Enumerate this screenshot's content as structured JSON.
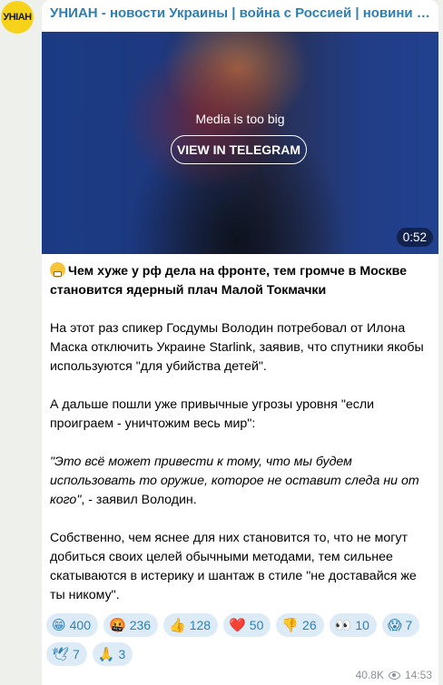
{
  "channel": {
    "avatar_text": "УНІАН",
    "title": "УНИАН - новости Украины | война с Россией | новини України | Україна | Ukraine"
  },
  "media": {
    "notice": "Media is too big",
    "button_label": "VIEW IN TELEGRAM",
    "duration": "0:52"
  },
  "message": {
    "headline": "Чем хуже у рф дела на фронте, тем громче в Москве становится ядерный плач Малой Токмачки",
    "p1": "На этот раз спикер Госдумы Володин потребовал от Илона Маска отключить Украине Starlink, заявив, что спутники якобы используются \"для убийства детей\".",
    "p2": "А дальше пошли уже привычные угрозы уровня \"если проиграем - уничтожим весь мир\":",
    "quote": "\"Это всё может привести к тому, что мы будем использовать то оружие, которое не оставит следа ни от кого\"",
    "quote_tail": ", - заявил Володин.",
    "p3": "Собственно, чем яснее для них становится то, что не могут добиться своих целей обычными методами, тем сильнее скатываются в истерику и шантаж в стиле \"не доставайся же ты никому\"."
  },
  "reactions": [
    {
      "emoji": "😁",
      "count": "400"
    },
    {
      "emoji": "🤬",
      "count": "236"
    },
    {
      "emoji": "👍",
      "count": "128"
    },
    {
      "emoji": "❤️",
      "count": "50"
    },
    {
      "emoji": "👎",
      "count": "26"
    },
    {
      "emoji": "👀",
      "count": "10"
    },
    {
      "emoji": "😱",
      "count": "7"
    },
    {
      "emoji": "🕊",
      "count": "7"
    },
    {
      "emoji": "🙏",
      "count": "3"
    }
  ],
  "footer": {
    "views": "40.8K",
    "time": "14:53"
  },
  "colors": {
    "accent": "#2f7fb3",
    "reaction_bg": "#ddebf7",
    "avatar_bg": "#f7d21a"
  }
}
